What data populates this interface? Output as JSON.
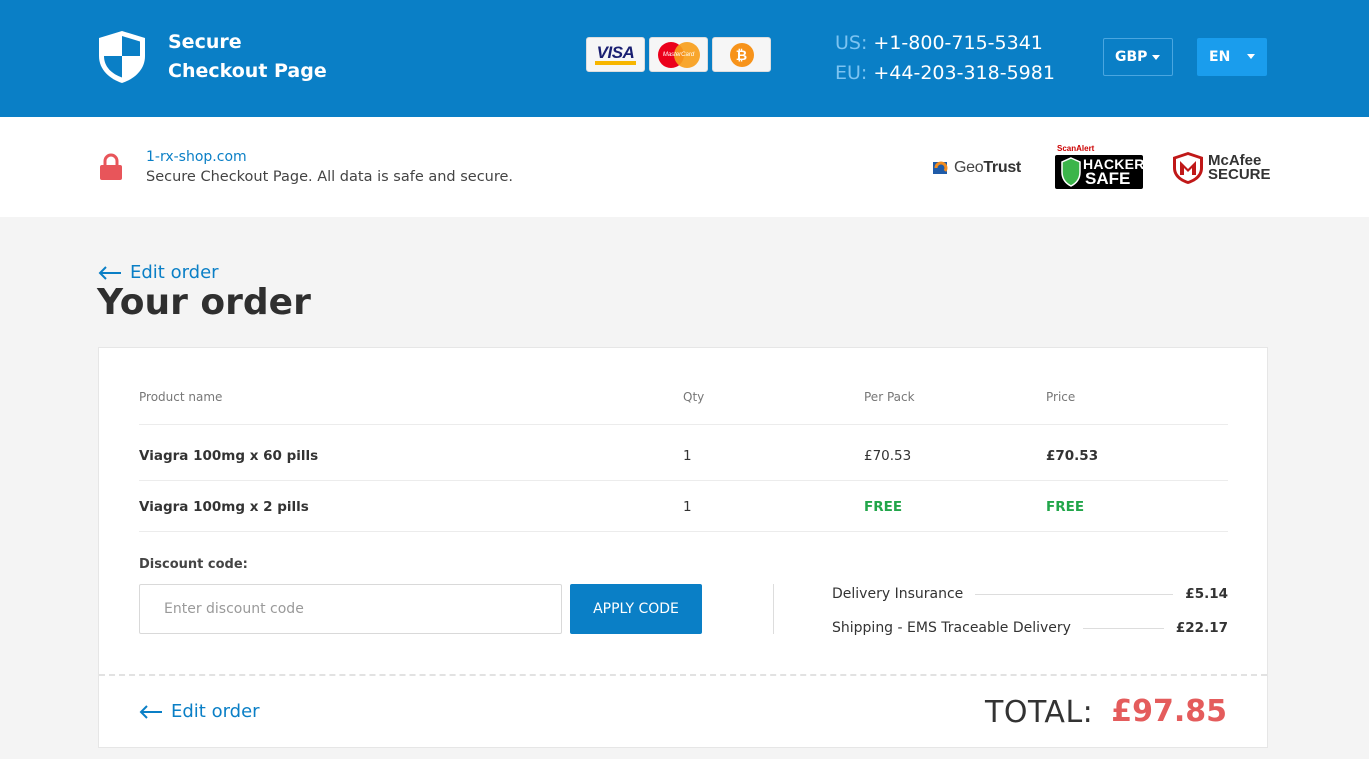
{
  "header": {
    "brand_line1": "Secure",
    "brand_line2": "Checkout Page",
    "payments": [
      {
        "name": "visa",
        "label": "VISA"
      },
      {
        "name": "mastercard",
        "label": "MasterCard"
      },
      {
        "name": "bitcoin",
        "label": "₿"
      }
    ],
    "phone_us_label": "US:",
    "phone_us": "+1-800-715-5341",
    "phone_eu_label": "EU:",
    "phone_eu": "+44-203-318-5981",
    "currency": "GBP",
    "language": "EN"
  },
  "secure_strip": {
    "site": "1-rx-shop.com",
    "message": "Secure Checkout Page. All data is safe and secure.",
    "badges": {
      "geotrust_a": "Geo",
      "geotrust_b": "Trust",
      "hacker_top": "ScanAlert",
      "hacker_1": "HACKER",
      "hacker_2": "SAFE",
      "mcafee_1": "McAfee",
      "mcafee_2": "SECURE"
    }
  },
  "order": {
    "edit_label": "Edit order",
    "title": "Your order",
    "columns": [
      "Product name",
      "Qty",
      "Per Pack",
      "Price"
    ],
    "rows": [
      {
        "product": "Viagra 100mg x 60 pills",
        "qty": "1",
        "per_pack": "£70.53",
        "price": "£70.53"
      },
      {
        "product": "Viagra 100mg x 2 pills",
        "qty": "1",
        "per_pack": "FREE",
        "price": "FREE"
      }
    ],
    "discount": {
      "label": "Discount code:",
      "placeholder": "Enter discount code",
      "value": "",
      "button": "APPLY CODE"
    },
    "fees": [
      {
        "label": "Delivery Insurance",
        "amount": "£5.14"
      },
      {
        "label": "Shipping - EMS Traceable Delivery",
        "amount": "£22.17"
      }
    ],
    "total_label": "TOTAL:",
    "total_value": "£97.85"
  },
  "colors": {
    "brand_blue": "#0a7fc6",
    "free_green": "#22a64a",
    "total_red": "#e45c5c",
    "lock_red": "#e8555a"
  }
}
